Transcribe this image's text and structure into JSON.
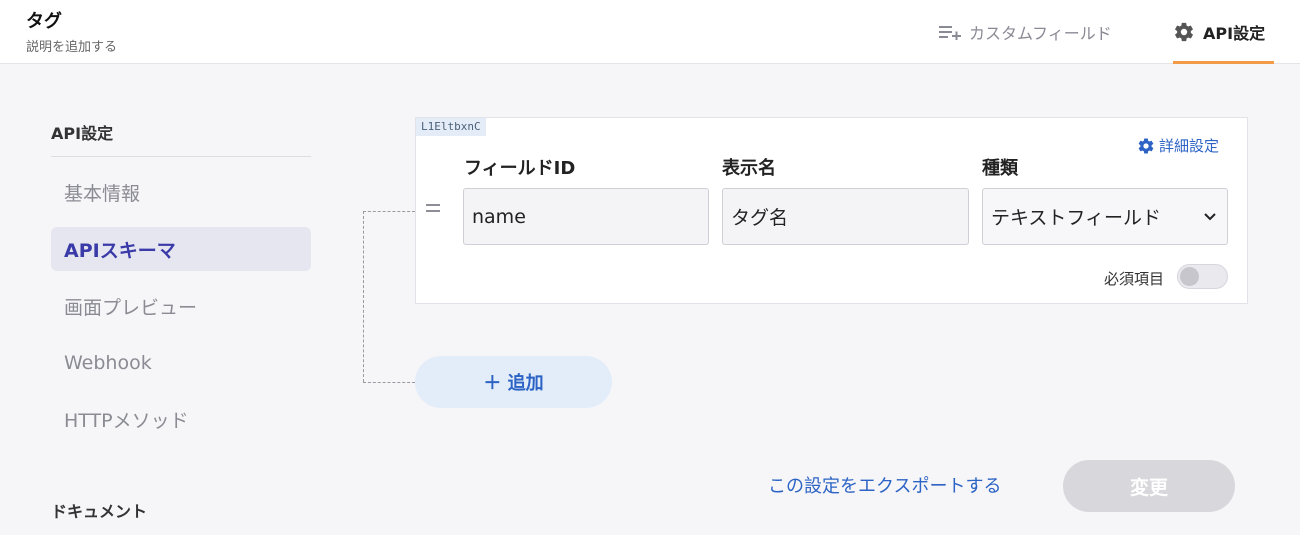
{
  "header": {
    "title": "タグ",
    "description": "説明を追加する",
    "tabs": {
      "custom_field": "カスタムフィールド",
      "api_settings": "API設定"
    }
  },
  "sidebar": {
    "section_heading": "API設定",
    "items": [
      "基本情報",
      "APIスキーマ",
      "画面プレビュー",
      "Webhook",
      "HTTPメソッド"
    ],
    "active_item": "APIスキーマ",
    "docs_heading": "ドキュメント"
  },
  "field": {
    "tag": "L1EltbxnC",
    "detail_settings": "詳細設定",
    "labels": {
      "field_id": "フィールドID",
      "display_name": "表示名",
      "type": "種類"
    },
    "values": {
      "field_id": "name",
      "display_name": "タグ名",
      "type": "テキストフィールド"
    },
    "required_label": "必須項目",
    "required": false
  },
  "actions": {
    "add": "＋ 追加",
    "export": "この設定をエクスポートする",
    "change": "変更"
  },
  "colors": {
    "accent": "#2c63c4",
    "active_tab_underline": "#f29c4a",
    "active_nav": "#3a3aa8"
  }
}
